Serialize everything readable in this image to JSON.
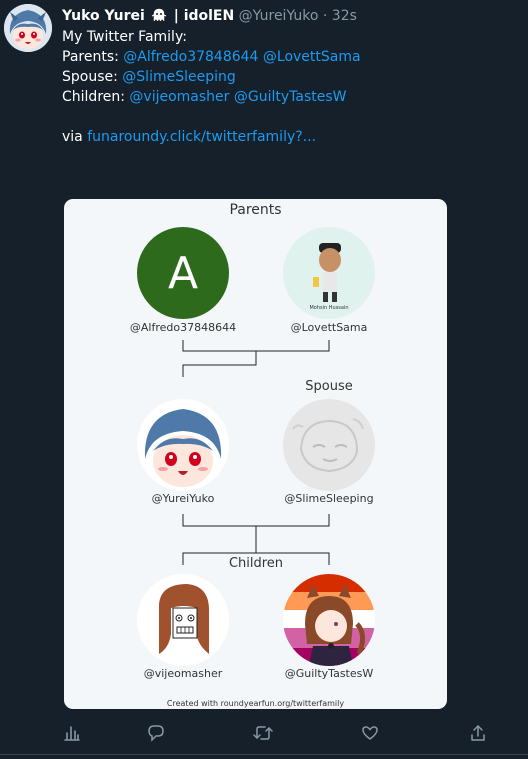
{
  "tweet": {
    "display_name": "Yuko Yurei",
    "name_suffix": "| idolEN",
    "handle": "@YureiYuko",
    "separator": "·",
    "time": "32s",
    "line1": "My Twitter Family:",
    "parents_label": "Parents:",
    "parent1_link": "@Alfredo37848644",
    "parent2_link": "@LovettSama",
    "spouse_label": "Spouse:",
    "spouse_link": "@SlimeSleeping",
    "children_label": "Children:",
    "child1_link": "@vijeomasher",
    "child2_link": "@GuiltyTastesW",
    "via_label": "via",
    "via_link": "funaroundy.click/twitterfamily?..."
  },
  "card": {
    "parents_title": "Parents",
    "spouse_title": "Spouse",
    "children_title": "Children",
    "parent1_initial": "A",
    "parent1_name": "@Alfredo37848644",
    "parent2_name": "@LovettSama",
    "self_name": "@YureiYuko",
    "spouse_name": "@SlimeSleeping",
    "child1_name": "@vijeomasher",
    "child2_name": "@GuiltyTastesW",
    "footer": "Created with roundyearfun.org/twitterfamily",
    "parent1_color": "#2d6a1c"
  },
  "actions": {
    "icons": [
      "analytics-icon",
      "reply-icon",
      "retweet-icon",
      "like-icon",
      "share-icon"
    ]
  },
  "colors": {
    "background": "#15202b",
    "link": "#1d9bf0",
    "muted": "#8899a6",
    "card_bg": "#f4f7f9"
  }
}
